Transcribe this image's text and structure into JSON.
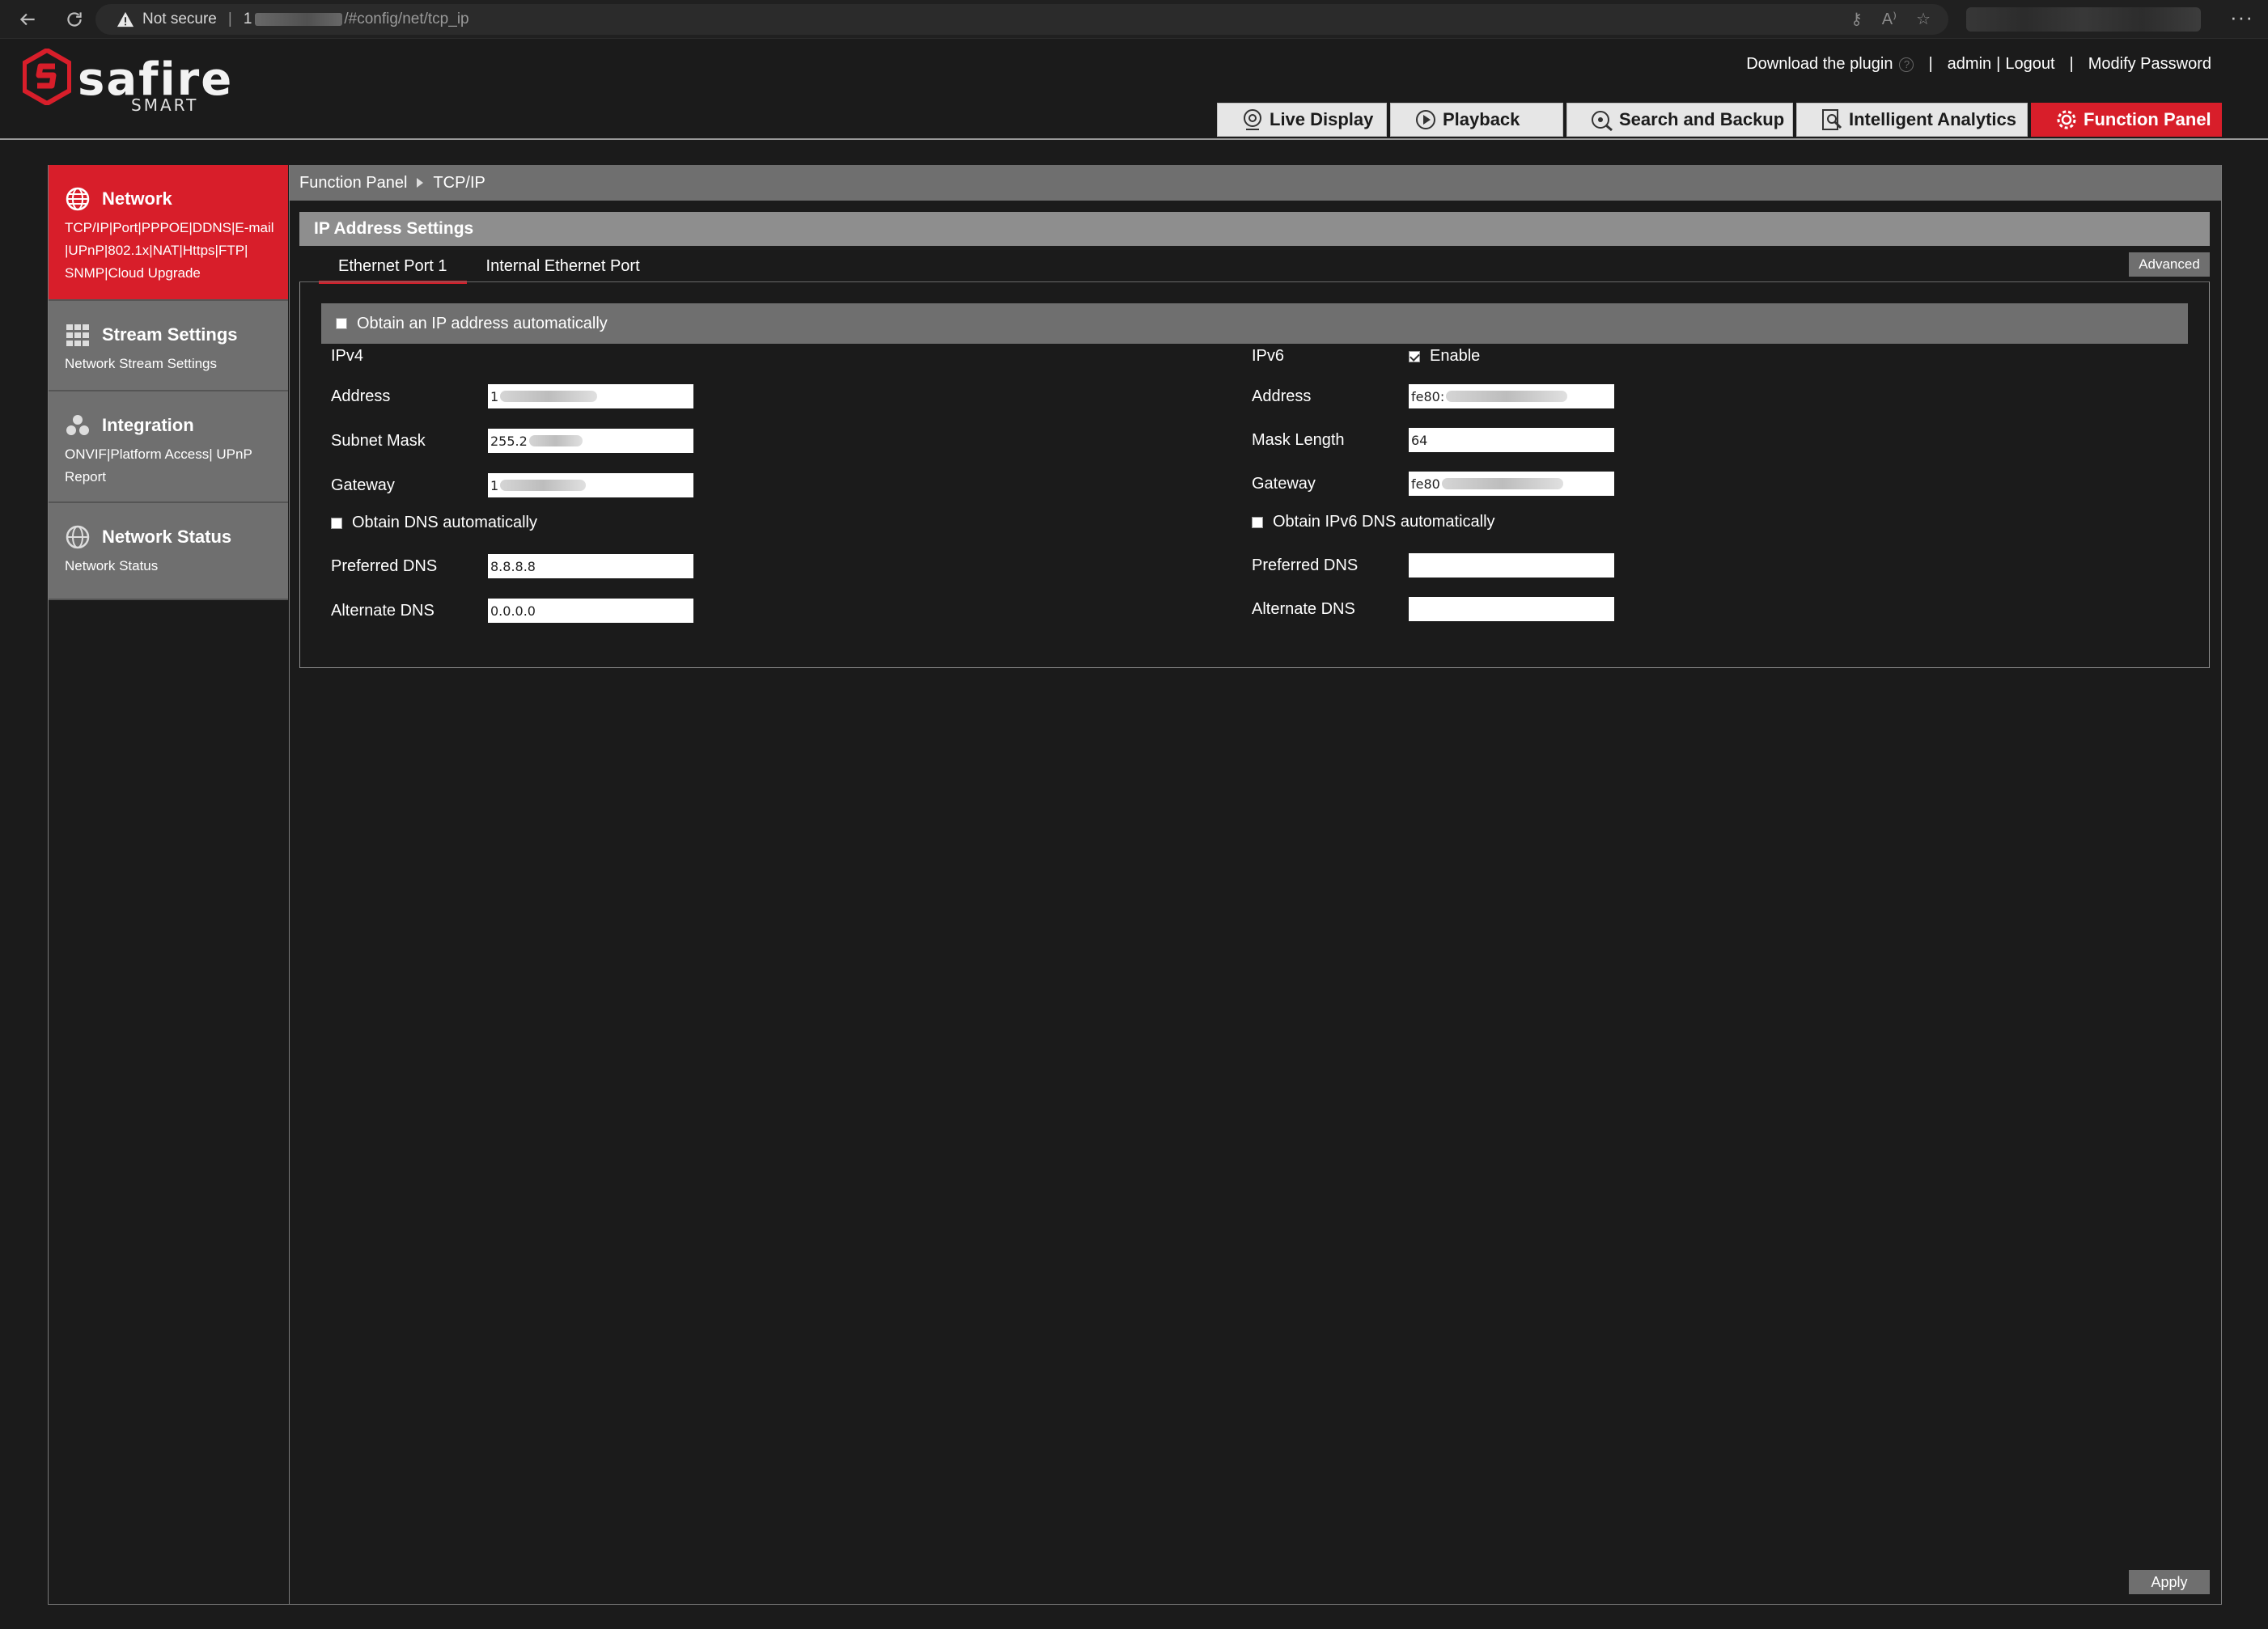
{
  "browser": {
    "security_label": "Not secure",
    "url_prefix": "1",
    "url_path": "/#config/net/tcp_ip"
  },
  "brand": {
    "name": "safire",
    "sub": "SMART"
  },
  "top_links": {
    "download": "Download the plugin",
    "user": "admin",
    "logout": "Logout",
    "modify_password": "Modify Password"
  },
  "main_tabs": [
    {
      "label": "Live Display",
      "icon": "live-display-icon"
    },
    {
      "label": "Playback",
      "icon": "play-icon"
    },
    {
      "label": "Search and Backup",
      "icon": "search-backup-icon"
    },
    {
      "label": "Intelligent Analytics",
      "icon": "analytics-icon"
    },
    {
      "label": "Function Panel",
      "icon": "gear-icon",
      "active": true
    }
  ],
  "sidebar": [
    {
      "title": "Network",
      "sub": "TCP/IP|Port|PPPOE|DDNS|E-mail |UPnP|802.1x|NAT|Https|FTP| SNMP|Cloud Upgrade",
      "icon": "globe-icon",
      "active": true
    },
    {
      "title": "Stream Settings",
      "sub": "Network Stream Settings",
      "icon": "grid-icon"
    },
    {
      "title": "Integration",
      "sub": "ONVIF|Platform Access| UPnP Report",
      "icon": "integration-icon"
    },
    {
      "title": "Network Status",
      "sub": "Network Status",
      "icon": "network-status-icon"
    }
  ],
  "breadcrumb": {
    "root": "Function Panel",
    "current": "TCP/IP"
  },
  "section_title": "IP Address Settings",
  "sub_tabs": [
    "Ethernet Port 1",
    "Internal Ethernet Port"
  ],
  "advanced_label": "Advanced",
  "obtain_ip_label": "Obtain an IP address automatically",
  "ipv4": {
    "heading": "IPv4",
    "address_label": "Address",
    "address_value": "1",
    "subnet_label": "Subnet Mask",
    "subnet_value": "255.2",
    "gateway_label": "Gateway",
    "gateway_value": "1",
    "obtain_dns_label": "Obtain DNS automatically",
    "preferred_dns_label": "Preferred DNS",
    "preferred_dns_value": "8.8.8.8",
    "alternate_dns_label": "Alternate DNS",
    "alternate_dns_value": "0.0.0.0"
  },
  "ipv6": {
    "heading": "IPv6",
    "enable_label": "Enable",
    "enable_checked": true,
    "address_label": "Address",
    "address_value": "fe80:",
    "mask_label": "Mask Length",
    "mask_value": "64",
    "gateway_label": "Gateway",
    "gateway_value": "fe80",
    "obtain_dns_label": "Obtain IPv6 DNS automatically",
    "preferred_dns_label": "Preferred DNS",
    "preferred_dns_value": "",
    "alternate_dns_label": "Alternate DNS",
    "alternate_dns_value": ""
  },
  "apply_label": "Apply",
  "colors": {
    "accent": "#d81e2a",
    "panel_gray": "#6f6f6f",
    "section_gray": "#8e8e8e",
    "background": "#1b1b1b"
  }
}
